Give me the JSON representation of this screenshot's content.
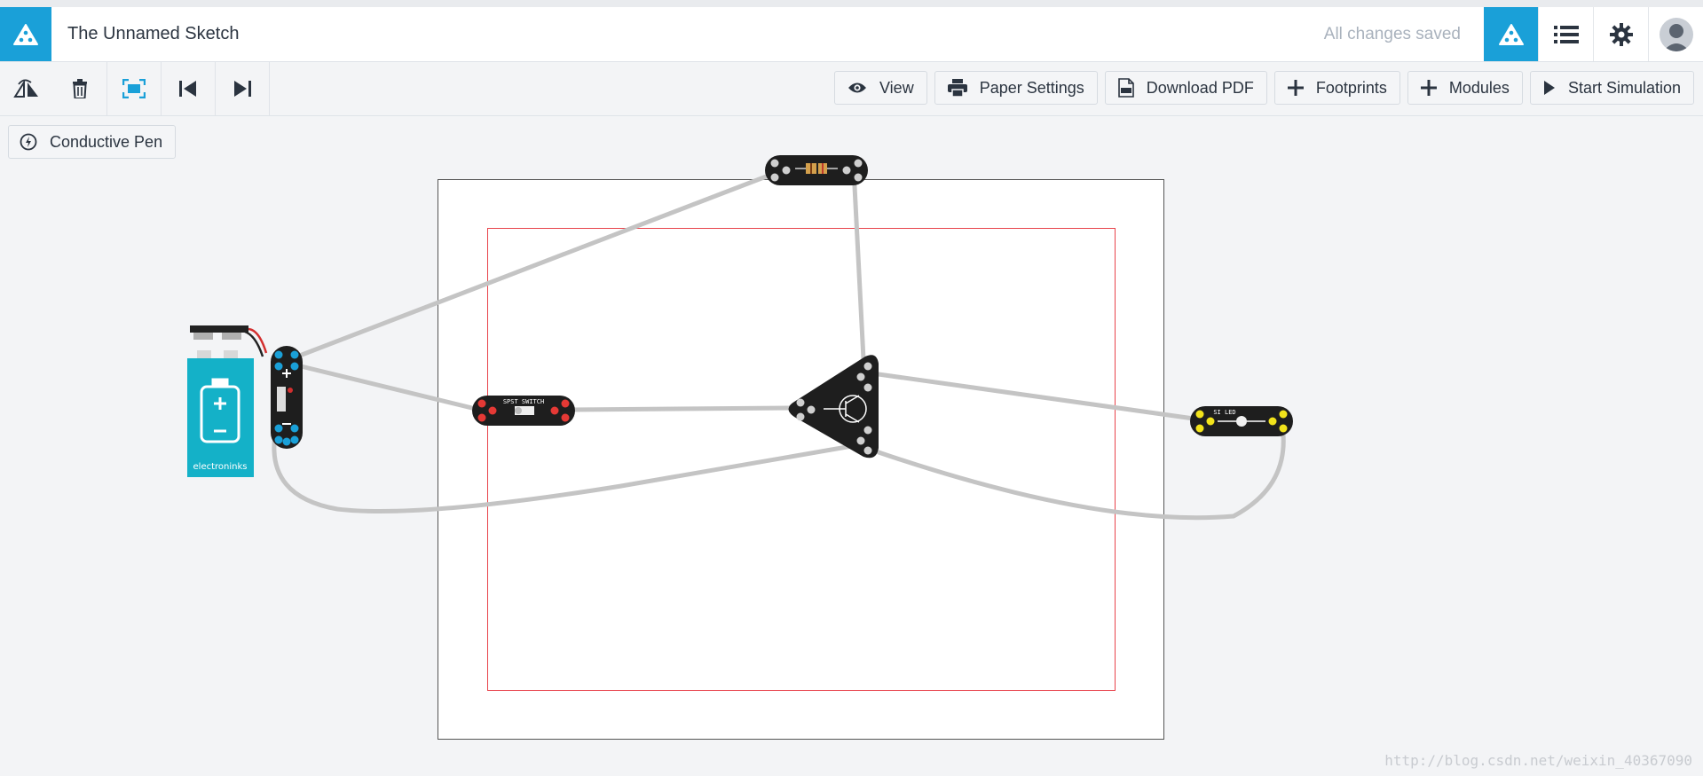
{
  "header": {
    "logo_icon": "electroninks-logo-icon",
    "title": "The Unnamed Sketch",
    "save_status": "All changes saved",
    "buttons": [
      "sketch-icon",
      "list-icon",
      "gear-icon",
      "user-avatar"
    ],
    "accent_color": "#1aa0d8"
  },
  "toolbar": {
    "tools": [
      "rotate-icon",
      "delete-icon",
      "fit-screen-icon",
      "undo-icon",
      "redo-icon"
    ],
    "actions": {
      "view": "View",
      "paper_settings": "Paper Settings",
      "download_pdf": "Download PDF",
      "footprints": "Footprints",
      "modules": "Modules",
      "start_simulation": "Start Simulation"
    }
  },
  "tool_panel": {
    "conductive_pen": "Conductive Pen"
  },
  "canvas": {
    "battery_brand": "electroninks",
    "modules": [
      {
        "name": "battery-connector",
        "pad_color": "#1aa0d8"
      },
      {
        "name": "spst-switch",
        "label": "SPST SWITCH",
        "pad_color": "#e53935"
      },
      {
        "name": "resistor",
        "pad_color": "#cfcfcf"
      },
      {
        "name": "npn-transistor",
        "label": "NPN TRANSISTOR",
        "pad_color": "#cfcfcf"
      },
      {
        "name": "led",
        "label": "SI LED",
        "pad_color": "#f2e31b"
      }
    ],
    "wire_color": "#c4c4c4",
    "paper_border_color": "#555555",
    "printable_area_color": "#e8434b"
  },
  "watermark": "http://blog.csdn.net/weixin_40367090"
}
